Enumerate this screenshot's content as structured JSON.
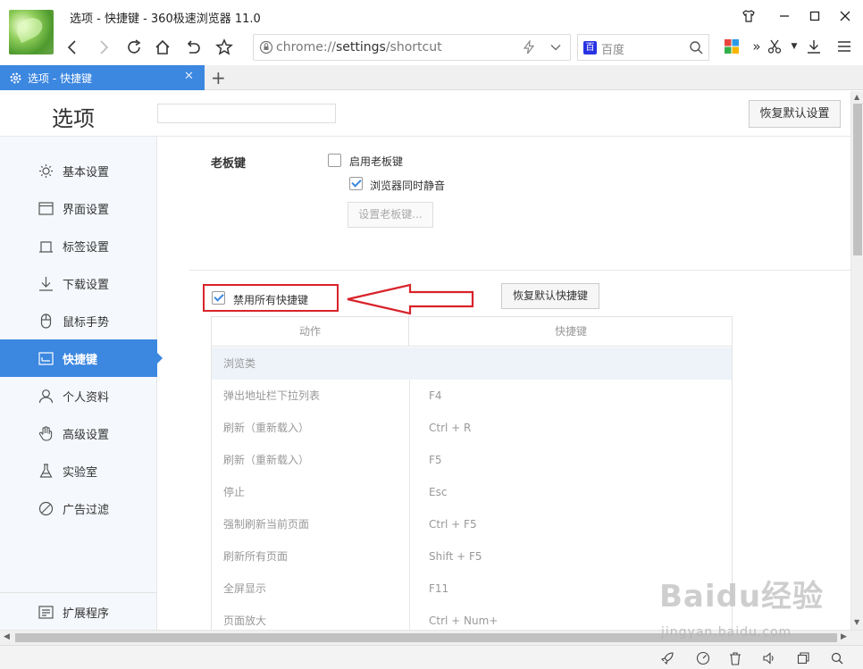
{
  "window": {
    "title": "选项 - 快捷键 - 360极速浏览器 11.0"
  },
  "address_bar": {
    "url_prefix": "chrome://",
    "url_bold": "settings",
    "url_suffix": "/shortcut"
  },
  "search_box": {
    "engine": "百度",
    "engine_icon_glyph": "百"
  },
  "tab": {
    "label": "选项 - 快捷键",
    "close_glyph": "✕",
    "new_tab_glyph": "+"
  },
  "page": {
    "title": "选项",
    "restore_defaults_label": "恢复默认设置"
  },
  "sidebar": {
    "items": [
      {
        "label": "基本设置",
        "icon": "sun-icon"
      },
      {
        "label": "界面设置",
        "icon": "window-icon"
      },
      {
        "label": "标签设置",
        "icon": "tab-icon"
      },
      {
        "label": "下载设置",
        "icon": "download-icon"
      },
      {
        "label": "鼠标手势",
        "icon": "mouse-icon"
      },
      {
        "label": "快捷键",
        "icon": "keyboard-icon",
        "active": true
      },
      {
        "label": "个人资料",
        "icon": "person-icon"
      },
      {
        "label": "高级设置",
        "icon": "hand-icon"
      },
      {
        "label": "实验室",
        "icon": "flask-icon"
      },
      {
        "label": "广告过滤",
        "icon": "block-icon"
      }
    ],
    "extensions_label": "扩展程序"
  },
  "boss_key": {
    "section_label": "老板键",
    "enable_label": "启用老板键",
    "enable_checked": false,
    "mute_label": "浏览器同时静音",
    "mute_checked": true,
    "set_button_label": "设置老板键..."
  },
  "shortcuts": {
    "disable_all_label": "禁用所有快捷键",
    "disable_all_checked": true,
    "restore_button_label": "恢复默认快捷键",
    "columns": [
      "动作",
      "快捷键"
    ],
    "group": "浏览类",
    "rows": [
      {
        "action": "弹出地址栏下拉列表",
        "key": "F4"
      },
      {
        "action": "刷新（重新载入）",
        "key": "Ctrl + R"
      },
      {
        "action": "刷新（重新载入）",
        "key": "F5"
      },
      {
        "action": "停止",
        "key": "Esc"
      },
      {
        "action": "强制刷新当前页面",
        "key": "Ctrl + F5"
      },
      {
        "action": "刷新所有页面",
        "key": "Shift + F5"
      },
      {
        "action": "全屏显示",
        "key": "F11"
      },
      {
        "action": "页面放大",
        "key": "Ctrl + Num+"
      }
    ]
  },
  "watermark": {
    "brand": "Baidu经验",
    "url": "jingyan.baidu.com"
  },
  "colors": {
    "accent": "#3c87e0",
    "highlight_red": "#d8232a",
    "sidebar_bg": "#f5f8fc"
  }
}
